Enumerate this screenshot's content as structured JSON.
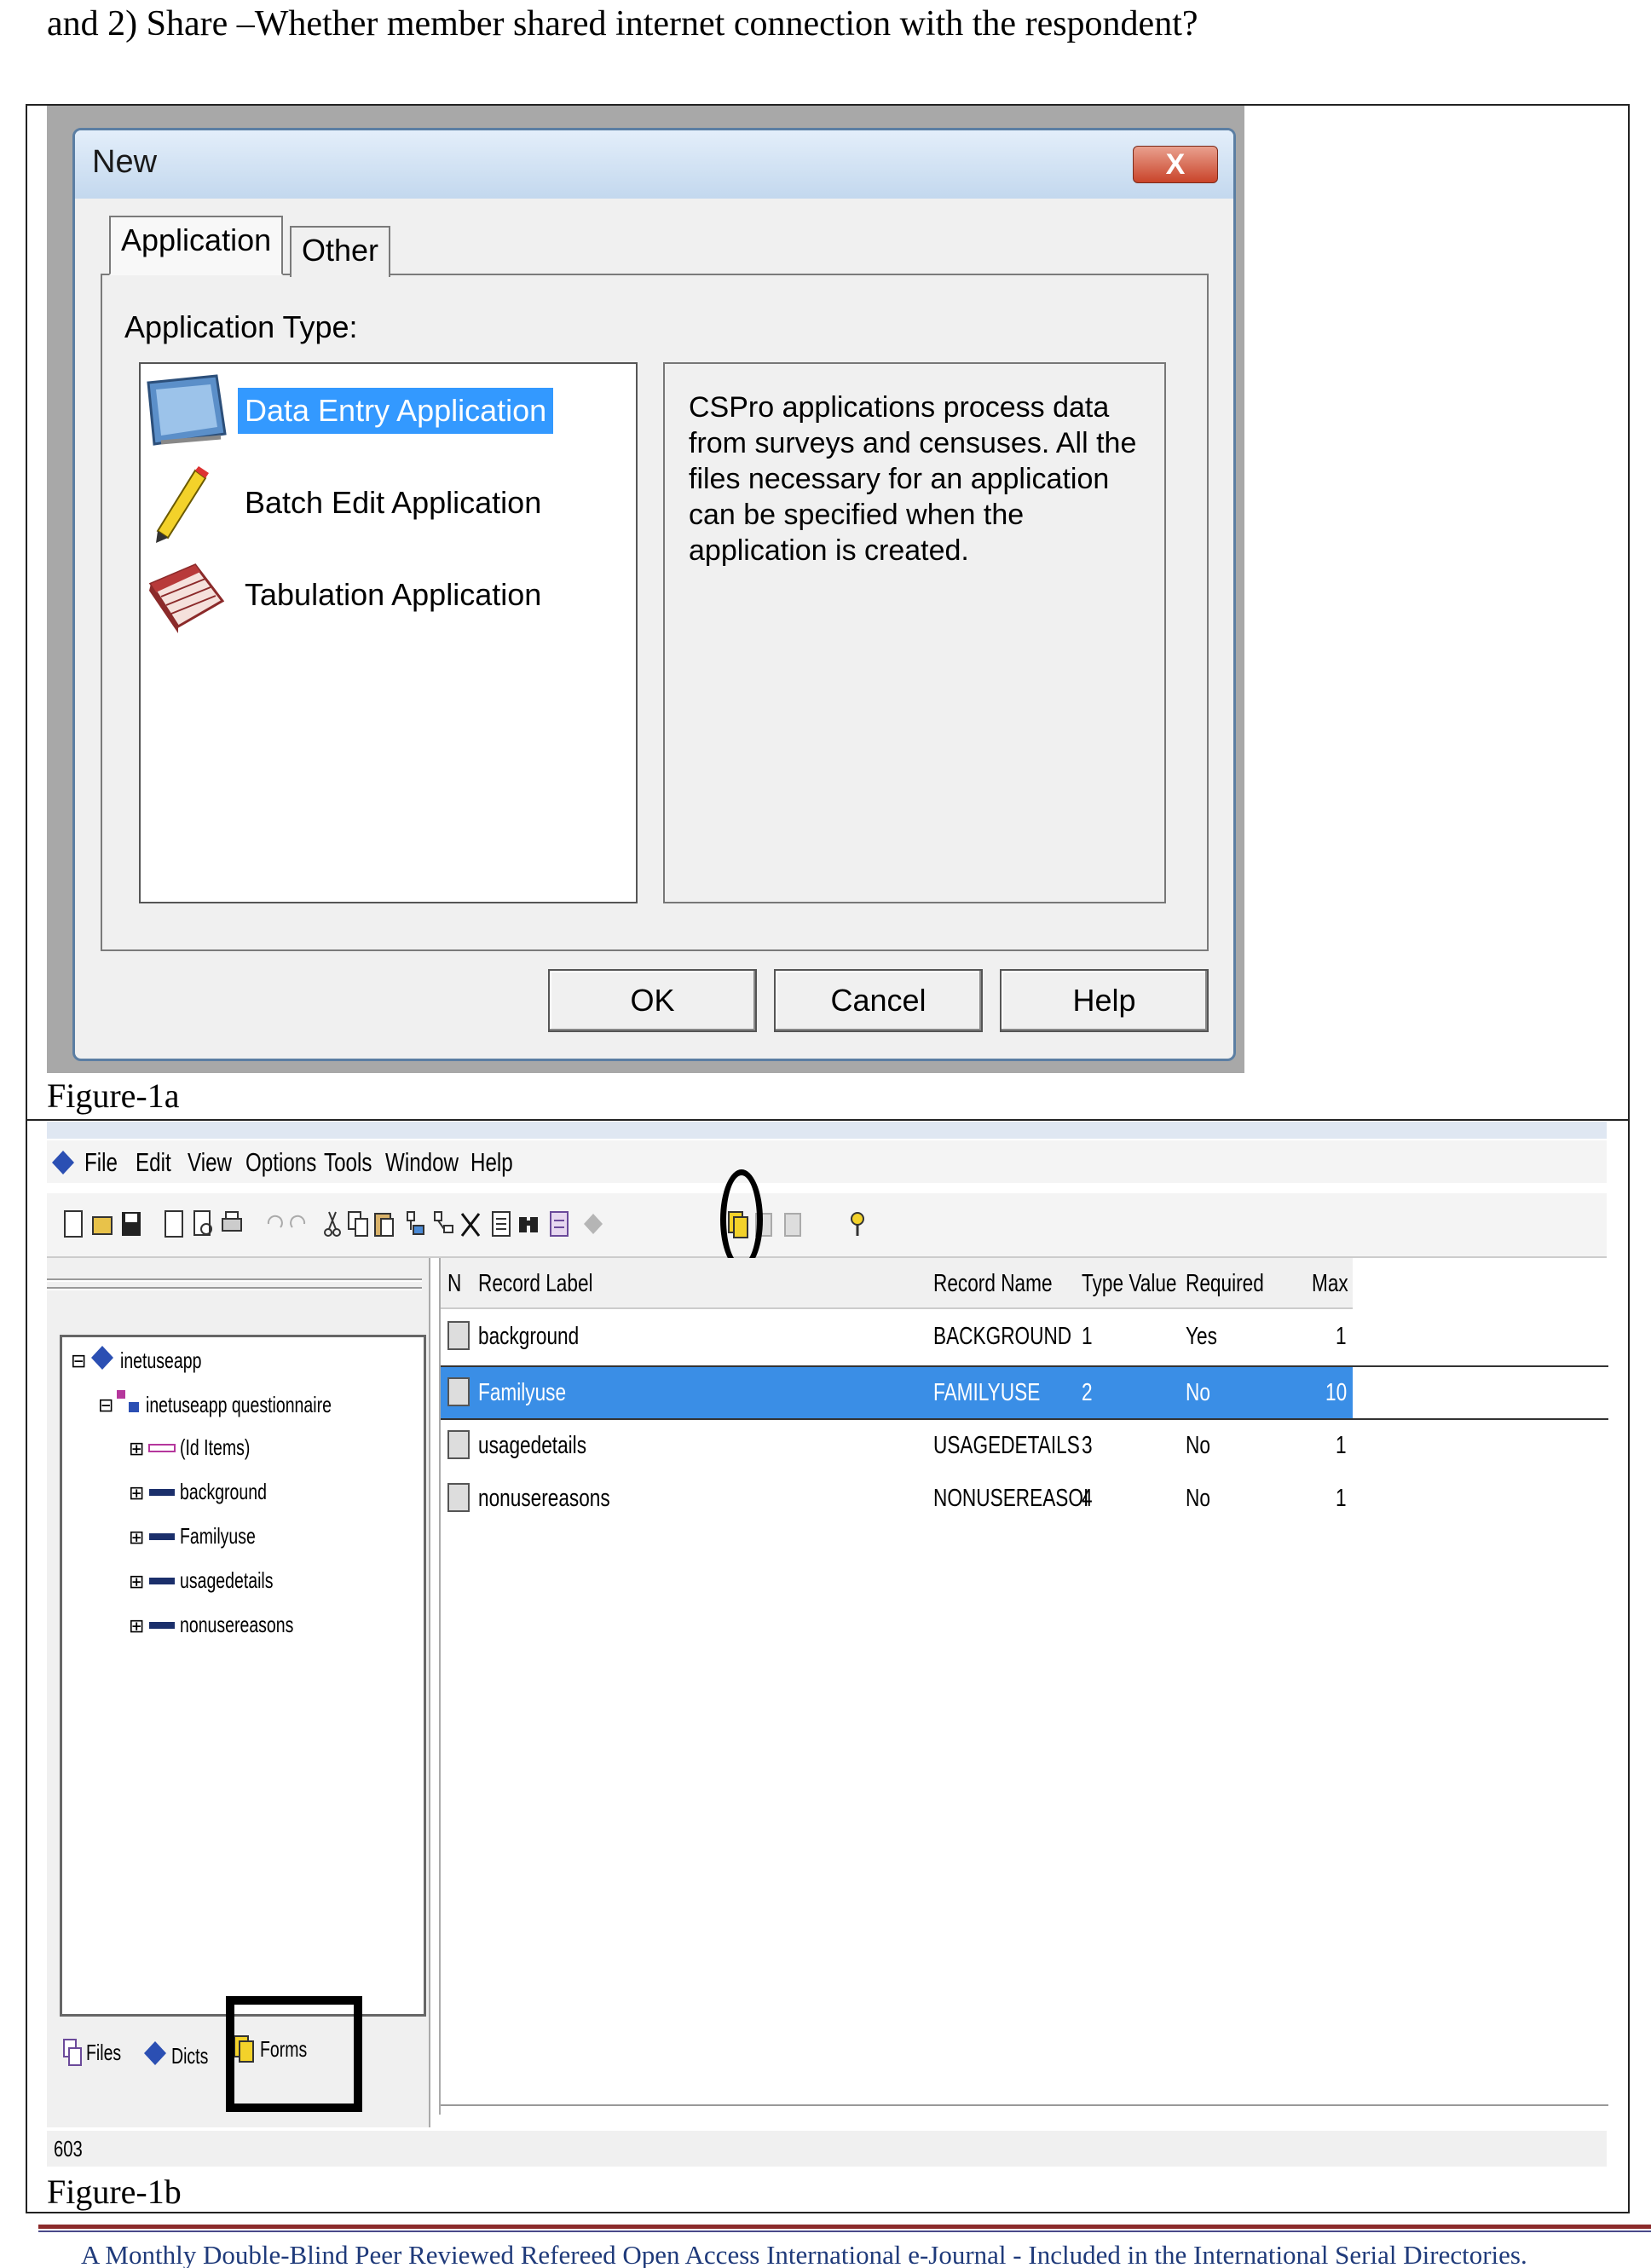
{
  "intro_text": "and 2) Share –Whether member shared internet connection with the respondent?",
  "figure_1a": {
    "caption": "Figure-1a",
    "dialog": {
      "title": "New",
      "close_glyph": "X",
      "tabs": [
        "Application",
        "Other"
      ],
      "application_type_label": "Application Type:",
      "applications": [
        {
          "label": "Data Entry Application",
          "icon": "data-entry-icon",
          "selected": true
        },
        {
          "label": "Batch Edit Application",
          "icon": "pencil-icon",
          "selected": false
        },
        {
          "label": "Tabulation Application",
          "icon": "tabulation-icon",
          "selected": false
        }
      ],
      "description": "CSPro applications process data from surveys and censuses.  All the files necessary for an application can be specified when the application is created.",
      "buttons": {
        "ok": "OK",
        "cancel": "Cancel",
        "help": "Help"
      }
    }
  },
  "figure_1b": {
    "caption": "Figure-1b",
    "menu": [
      "File",
      "Edit",
      "View",
      "Options",
      "Tools",
      "Window",
      "Help"
    ],
    "tree": {
      "root": "inetuseapp",
      "questionnaire": "inetuseapp questionnaire",
      "items": [
        "(Id Items)",
        "background",
        "Familyuse",
        "usagedetails",
        "nonusereasons"
      ]
    },
    "pane_tabs": [
      "Files",
      "Dicts",
      "Forms"
    ],
    "grid": {
      "headers": [
        "N",
        "Record Label",
        "Record Name",
        "Type Value",
        "Required",
        "Max"
      ],
      "rows": [
        {
          "label": "background",
          "name": "BACKGROUND",
          "type_value": "1",
          "required": "Yes",
          "max": "1"
        },
        {
          "label": "Familyuse",
          "name": "FAMILYUSE",
          "type_value": "2",
          "required": "No",
          "max": "10"
        },
        {
          "label": "usagedetails",
          "name": "USAGEDETAILS",
          "type_value": "3",
          "required": "No",
          "max": "1"
        },
        {
          "label": "nonusereasons",
          "name": "NONUSEREASOI",
          "type_value": "4",
          "required": "No",
          "max": "1"
        }
      ],
      "selected_row": 1
    },
    "status_text": "603"
  },
  "footer_text": "A Monthly Double-Blind Peer Reviewed Refereed Open Access International e-Journal - Included in the International Serial Directories."
}
